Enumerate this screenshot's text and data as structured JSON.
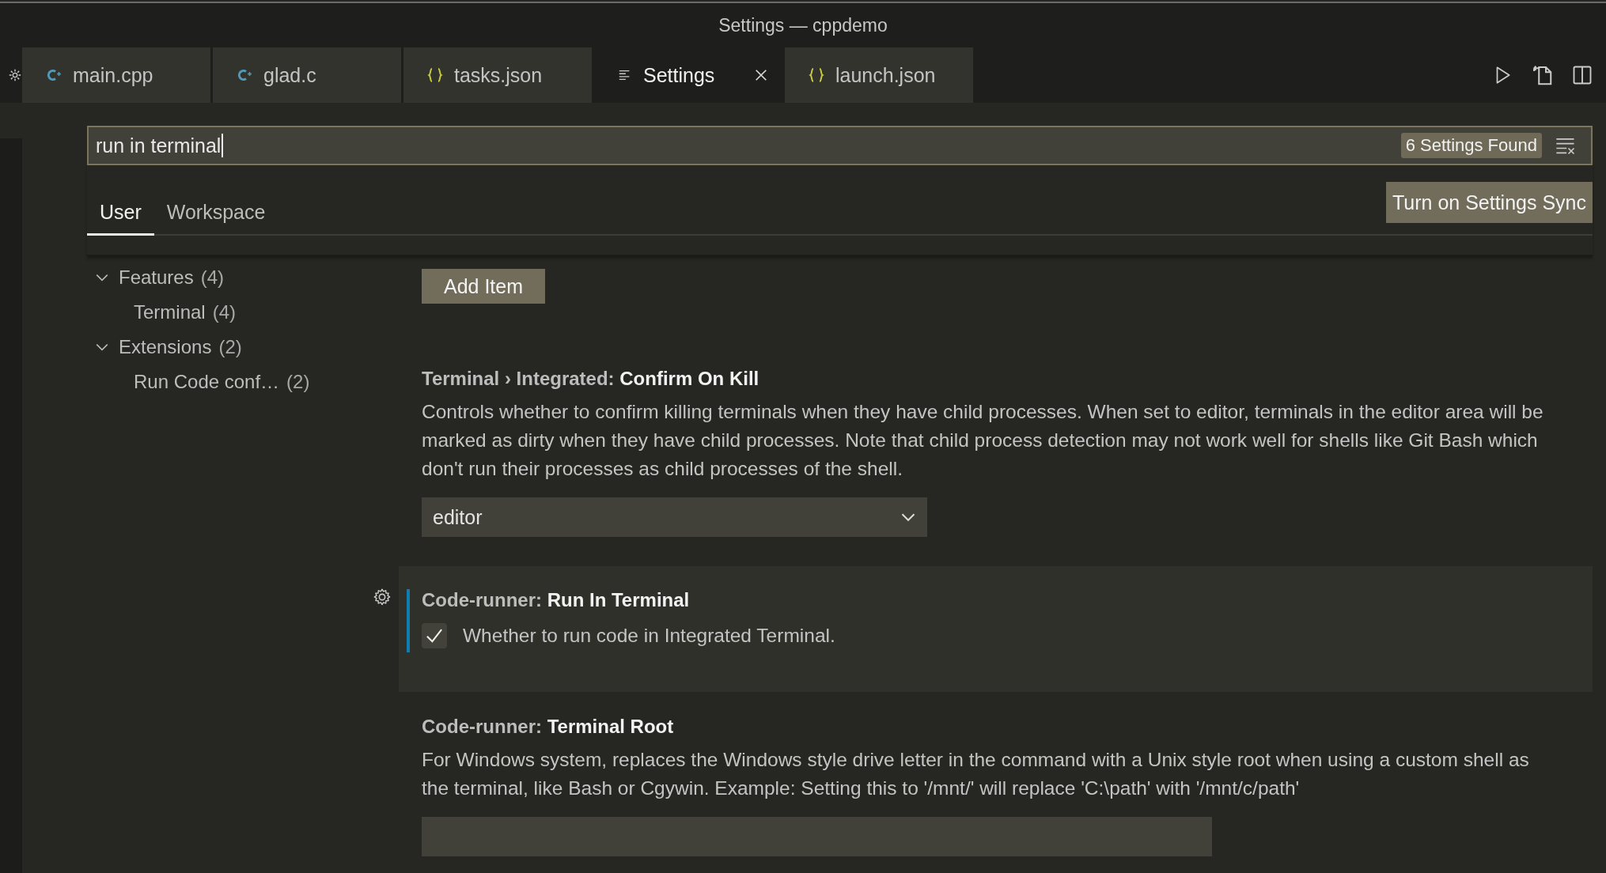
{
  "window": {
    "title": "Settings — cppdemo"
  },
  "tabs": [
    {
      "label": "main.cpp",
      "kind": "cpp",
      "selected": false
    },
    {
      "label": "glad.c",
      "kind": "cpp",
      "selected": false
    },
    {
      "label": "tasks.json",
      "kind": "json",
      "selected": false
    },
    {
      "label": "Settings",
      "kind": "settings",
      "selected": true
    },
    {
      "label": "launch.json",
      "kind": "json",
      "selected": false
    }
  ],
  "search": {
    "value": "run in terminal",
    "result_count": "6 Settings Found"
  },
  "scope_tabs": [
    {
      "label": "User",
      "selected": true
    },
    {
      "label": "Workspace",
      "selected": false
    }
  ],
  "sync_button": "Turn on Settings Sync",
  "toc": [
    {
      "label": "Features",
      "count": "(4)",
      "expanded": true,
      "children": [
        {
          "label": "Terminal",
          "count": "(4)"
        }
      ]
    },
    {
      "label": "Extensions",
      "count": "(2)",
      "expanded": true,
      "children": [
        {
          "label": "Run Code conf…",
          "count": "(2)"
        }
      ]
    }
  ],
  "add_item_button": "Add Item",
  "settings": [
    {
      "kind": "dropdown",
      "title": "Terminal › Integrated: **Confirm On Kill**",
      "description": "Controls whether to confirm killing terminals when they have child processes. When set to editor, terminals in the editor area will be marked as dirty when they have child processes. Note that child process detection may not work well for shells like Git Bash which don't run their processes as child processes of the shell.",
      "value": "editor",
      "focused": false
    },
    {
      "kind": "checkbox",
      "title": "Code-runner: **Run In Terminal**",
      "description": "Whether to run code in Integrated Terminal.",
      "checked": true,
      "focused": true
    },
    {
      "kind": "text",
      "title": "Code-runner: **Terminal Root**",
      "description": "For Windows system, replaces the Windows style drive letter in the command with a Unix style root when using a custom shell as the terminal, like Bash or Cgywin. Example: Setting this to '/mnt/' will replace 'C:\\path' with '/mnt/c/path'",
      "focused": false
    }
  ]
}
